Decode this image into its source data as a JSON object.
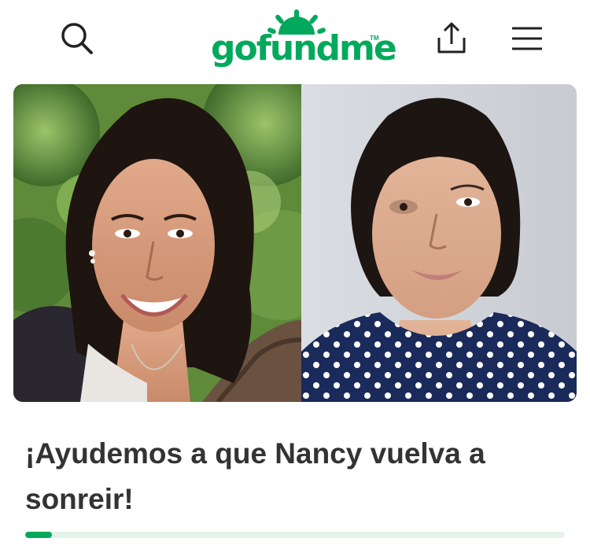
{
  "header": {
    "logo_text": "gofundme",
    "logo_trademark": "TM",
    "icons": {
      "search": "search-icon",
      "share": "share-icon",
      "menu": "menu-icon"
    }
  },
  "hero": {
    "images": [
      "before-photo",
      "after-photo"
    ]
  },
  "campaign": {
    "title": "¡Ayudemos a que Nancy vuelva a sonreir!",
    "progress_fraction": 0.05
  },
  "colors": {
    "brand_green": "#02a95c",
    "progress_track": "#e3f3ea",
    "title_text": "#333333"
  }
}
